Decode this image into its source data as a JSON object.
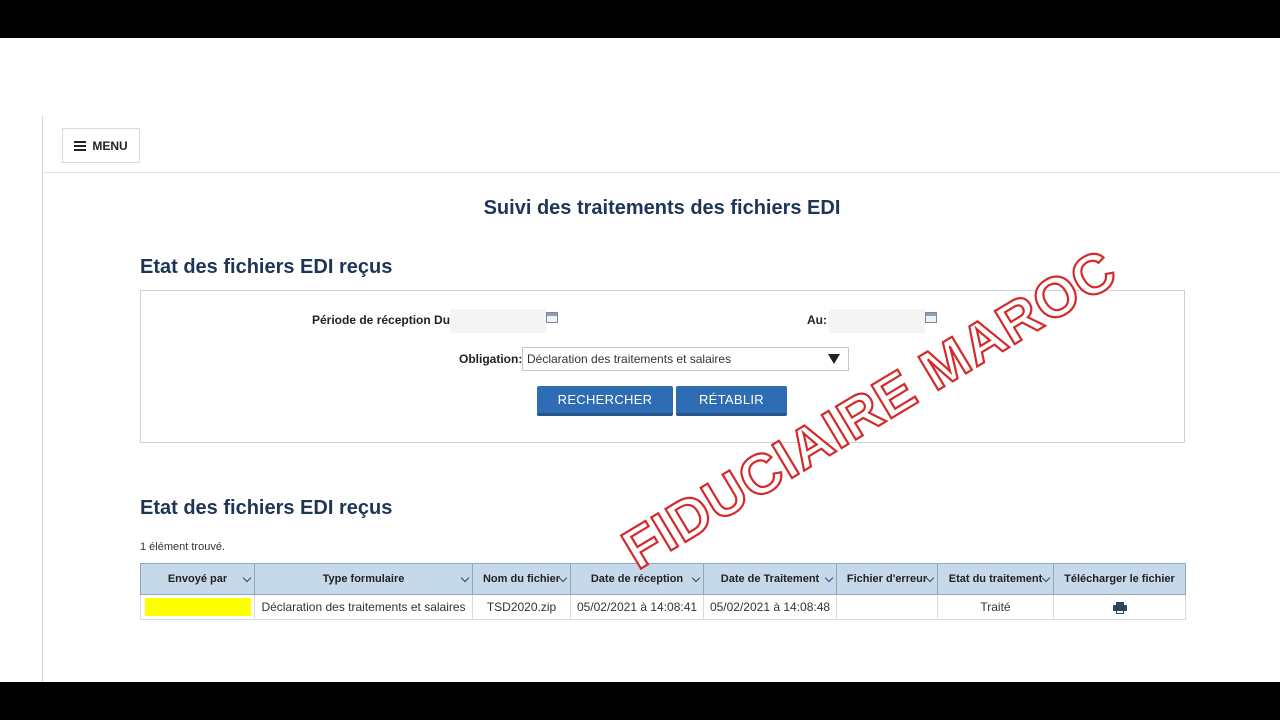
{
  "menu": {
    "label": "MENU"
  },
  "page": {
    "title": "Suivi des traitements des fichiers EDI"
  },
  "search_section": {
    "title": "Etat des fichiers EDI reçus",
    "period_from_label": "Période de réception Du:",
    "period_from_value": "",
    "period_to_label": "Au:",
    "period_to_value": "",
    "obligation_label": "Obligation:",
    "obligation_value": "Déclaration des traitements et salaires",
    "search_button": "RECHERCHER",
    "reset_button": "RÉTABLIR"
  },
  "results_section": {
    "title": "Etat des fichiers EDI reçus",
    "count_text": "1 élément trouvé.",
    "columns": [
      "Envoyé par",
      "Type formulaire",
      "Nom du fichier",
      "Date de réception",
      "Date de Traitement",
      "Fichier d'erreur",
      "Etat du traitement",
      "Télécharger le fichier"
    ],
    "rows": [
      {
        "sent_by": "",
        "form_type": "Déclaration des traitements et salaires",
        "file_name": "TSD2020.zip",
        "received_date": "05/02/2021 à 14:08:41",
        "processed_date": "05/02/2021 à 14:08:48",
        "error_file": "",
        "status": "Traité",
        "download_icon": "printer-icon"
      }
    ]
  },
  "watermark": {
    "text": "FIDUCIAIRE MAROC",
    "color": "#d42a2a"
  },
  "colors": {
    "accent": "#2e6db3",
    "title": "#1d3557",
    "header_bg": "#c6d9ea",
    "highlight": "#ffff00"
  }
}
